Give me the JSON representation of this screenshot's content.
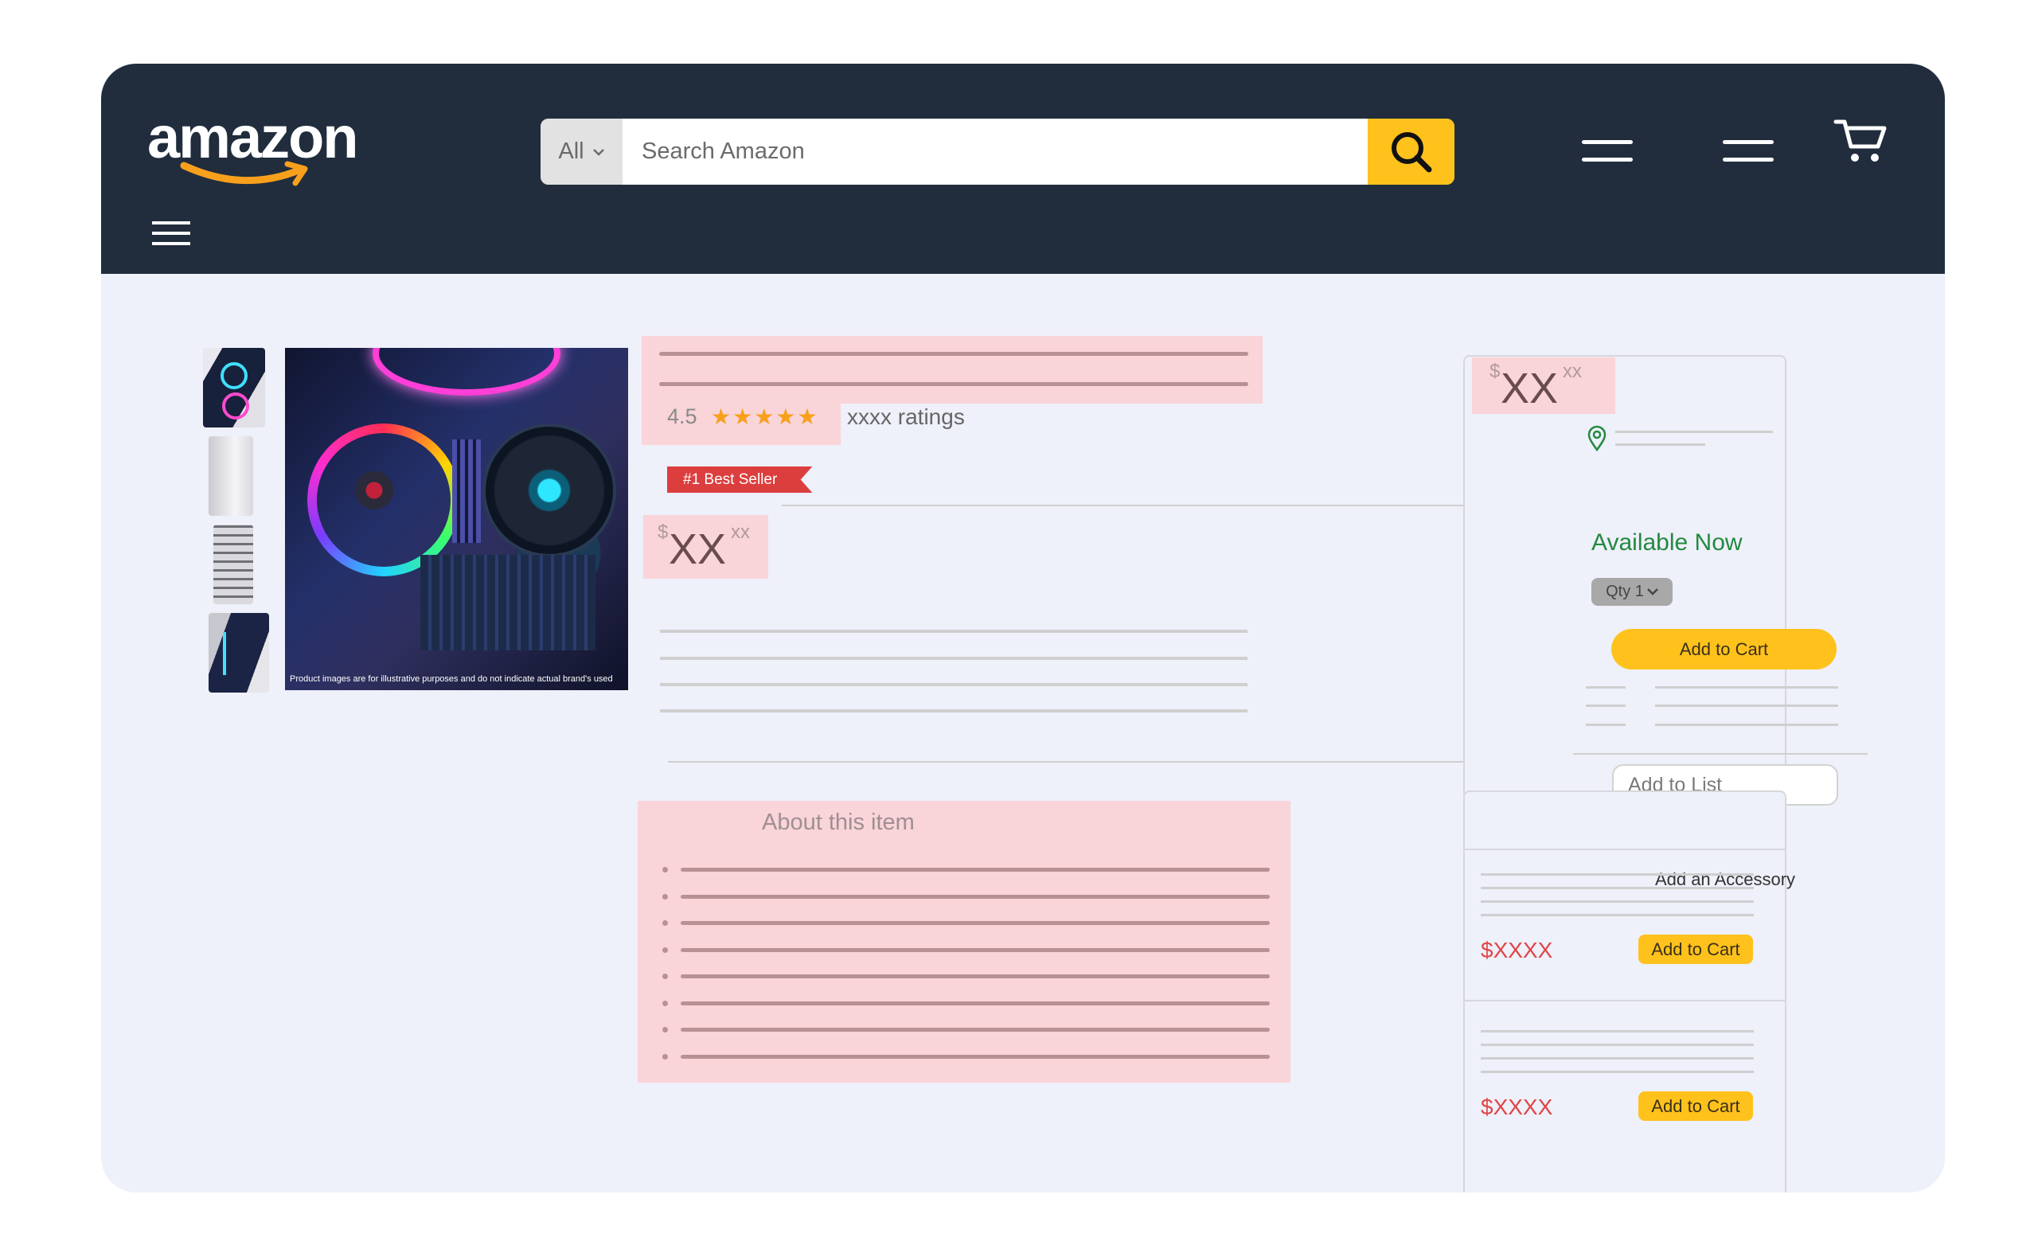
{
  "header": {
    "logo_text": "amazon",
    "search": {
      "category": "All",
      "placeholder": "Search Amazon"
    }
  },
  "product": {
    "image_caption": "Product images are for illustrative purposes and do not indicate actual brand's used",
    "rating": "4.5",
    "stars": "★★★★★",
    "ratings_count": "xxxx ratings",
    "badge": "#1 Best Seller",
    "price": {
      "currency": "$",
      "whole": "XX",
      "fraction": "xx"
    },
    "about_title": "About this item",
    "about_bullets": 8
  },
  "buy_box": {
    "price": {
      "currency": "$",
      "whole": "XX",
      "fraction": "xx"
    },
    "availability": "Available Now",
    "qty": "Qty 1",
    "add_to_cart": "Add to Cart",
    "add_to_list": "Add to List"
  },
  "accessory": {
    "title": "Add an Accessory",
    "items": [
      {
        "price": "$XXXX",
        "button": "Add to Cart"
      },
      {
        "price": "$XXXX",
        "button": "Add to Cart"
      }
    ]
  },
  "colors": {
    "nav_bg": "#212d3d",
    "accent_yellow": "#ffc21c",
    "smile_orange": "#f8a01c",
    "badge_red": "#dc3e3e",
    "available_green": "#238a3f",
    "placeholder_pink": "#f9d4d9"
  }
}
